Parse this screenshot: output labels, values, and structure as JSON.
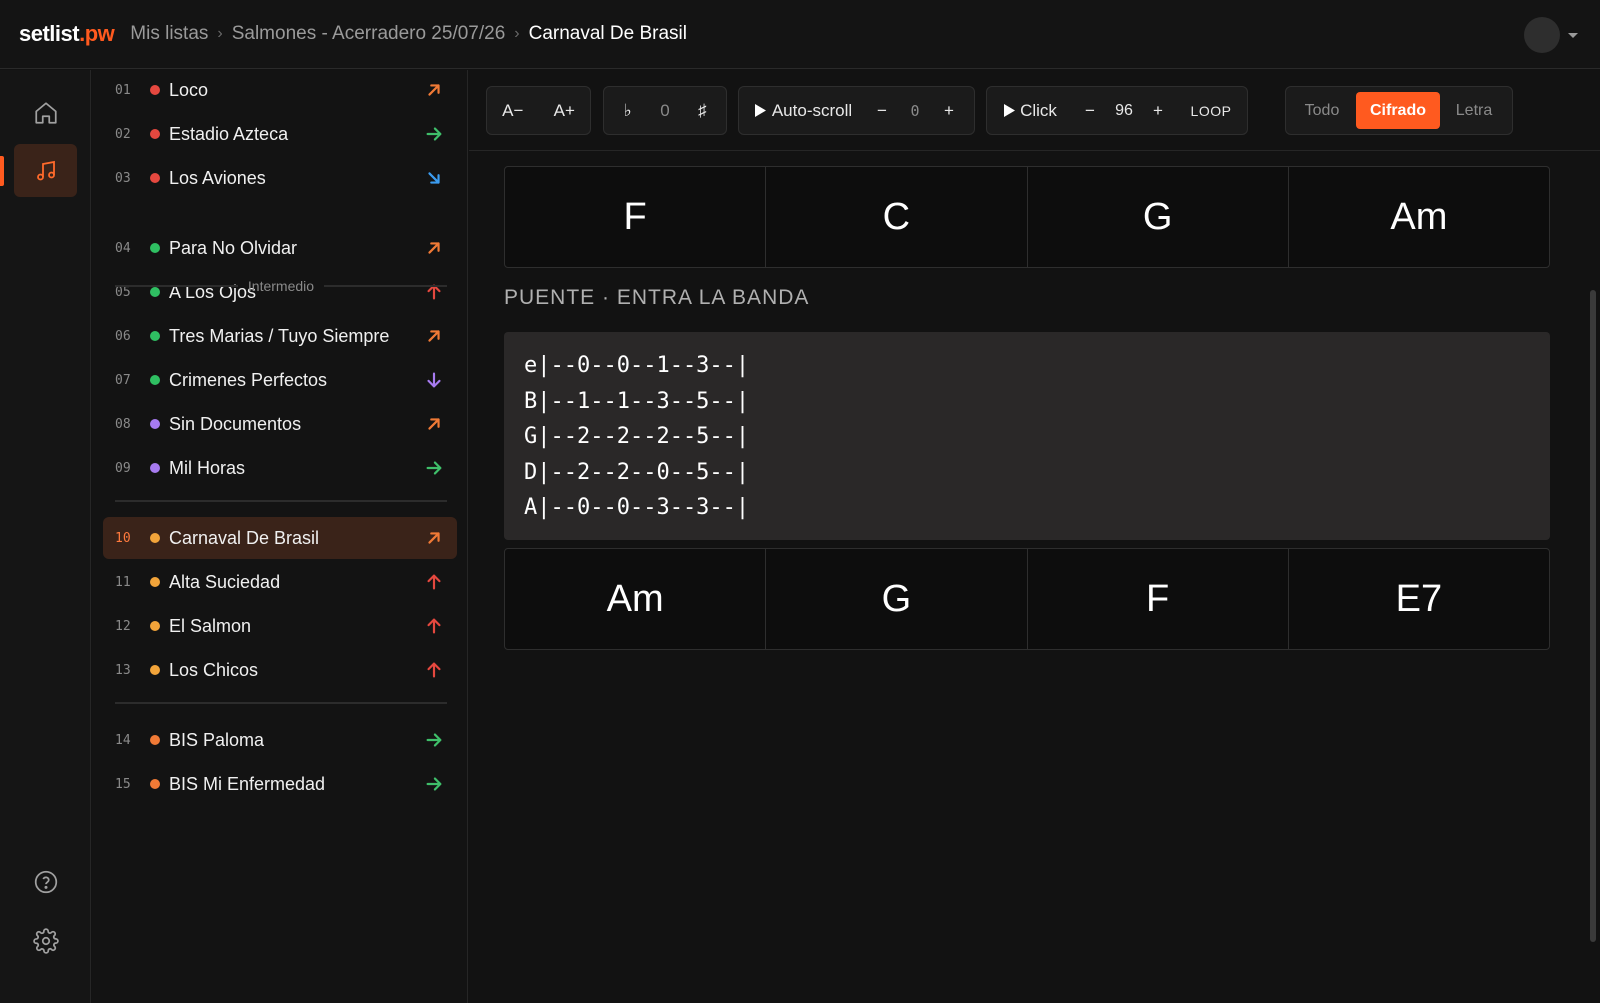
{
  "header": {
    "logo_main": "setlist",
    "logo_tld": ".pw",
    "breadcrumbs": [
      "Mis listas",
      "Salmones - Acerradero 25/07/26",
      "Carnaval De Brasil"
    ]
  },
  "rail": {
    "items": [
      {
        "icon": "home-icon"
      },
      {
        "icon": "music-note-icon",
        "active": true
      },
      {
        "icon": "help-icon"
      },
      {
        "icon": "gear-icon"
      }
    ]
  },
  "setlist": {
    "section_label": "Intermedio",
    "songs": [
      {
        "num": "01",
        "title": "Loco",
        "dot": "#e5483f",
        "arrow": "up-right",
        "arrow_color": "#f07a36"
      },
      {
        "num": "02",
        "title": "Estadio Azteca",
        "dot": "#e5483f",
        "arrow": "right",
        "arrow_color": "#3fbf6a"
      },
      {
        "num": "03",
        "title": "Los Aviones",
        "dot": "#e5483f",
        "arrow": "down-right",
        "arrow_color": "#3b9cf0"
      },
      {
        "num": "04",
        "title": "Para No Olvidar",
        "dot": "#2fbf62",
        "arrow": "up-right",
        "arrow_color": "#f07a36"
      },
      {
        "num": "05",
        "title": "A Los Ojos",
        "dot": "#2fbf62",
        "arrow": "up",
        "arrow_color": "#e5483f"
      },
      {
        "num": "06",
        "title": "Tres Marias / Tuyo Siempre",
        "dot": "#2fbf62",
        "arrow": "up-right",
        "arrow_color": "#f07a36"
      },
      {
        "num": "07",
        "title": "Crimenes Perfectos",
        "dot": "#2fbf62",
        "arrow": "down",
        "arrow_color": "#a77bf0"
      },
      {
        "num": "08",
        "title": "Sin Documentos",
        "dot": "#a77bf0",
        "arrow": "up-right",
        "arrow_color": "#f07a36"
      },
      {
        "num": "09",
        "title": "Mil Horas",
        "dot": "#a77bf0",
        "arrow": "right",
        "arrow_color": "#3fbf6a"
      },
      {
        "num": "10",
        "title": "Carnaval De Brasil",
        "dot": "#f2a43a",
        "arrow": "up-right",
        "arrow_color": "#f07a36",
        "active": true
      },
      {
        "num": "11",
        "title": "Alta Suciedad",
        "dot": "#f2a43a",
        "arrow": "up",
        "arrow_color": "#e5483f"
      },
      {
        "num": "12",
        "title": "El Salmon",
        "dot": "#f2a43a",
        "arrow": "up",
        "arrow_color": "#e5483f"
      },
      {
        "num": "13",
        "title": "Los Chicos",
        "dot": "#f2a43a",
        "arrow": "up",
        "arrow_color": "#e5483f"
      },
      {
        "num": "14",
        "title": "BIS Paloma",
        "dot": "#f07a36",
        "arrow": "right",
        "arrow_color": "#3fbf6a"
      },
      {
        "num": "15",
        "title": "BIS Mi Enfermedad",
        "dot": "#f07a36",
        "arrow": "right",
        "arrow_color": "#3fbf6a"
      }
    ]
  },
  "toolbar": {
    "font_smaller": "A−",
    "font_larger": "A+",
    "flat": "♭",
    "transpose_value": "0",
    "sharp": "♯",
    "autoscroll_label": "Auto-scroll",
    "autoscroll_minus": "−",
    "autoscroll_value": "0",
    "autoscroll_plus": "+",
    "click_label": "Click",
    "bpm_minus": "−",
    "bpm_value": "96",
    "bpm_plus": "+",
    "loop_label": "LOOP",
    "views": [
      "Todo",
      "Cifrado",
      "Letra"
    ],
    "active_view": "Cifrado"
  },
  "content": {
    "chords_top": [
      "F",
      "C",
      "G",
      "Am"
    ],
    "section_title": "PUENTE · ENTRA LA BANDA",
    "tab_lines": [
      "e|--0--0--1--3--|",
      "B|--1--1--3--5--|",
      "G|--2--2--2--5--|",
      "D|--2--2--0--5--|",
      "A|--0--0--3--3--|"
    ],
    "chords_bottom": [
      "Am",
      "G",
      "F",
      "E7"
    ]
  },
  "colors": {
    "accent": "#ff5a1f",
    "active_row": "#3a2319"
  }
}
